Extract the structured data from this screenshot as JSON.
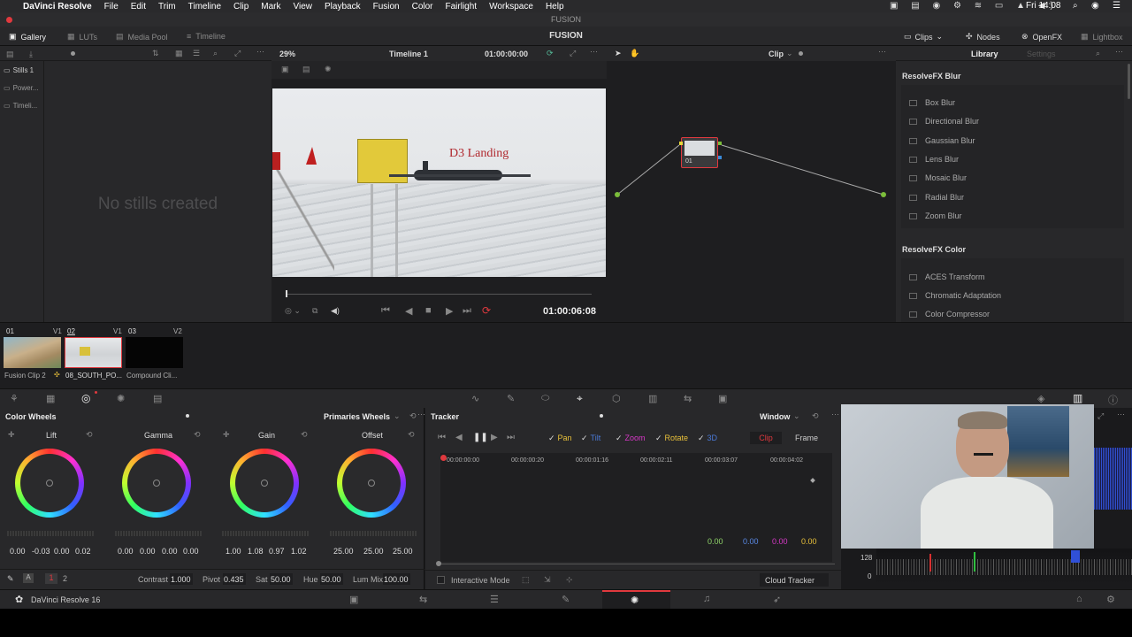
{
  "menubar": {
    "app": "DaVinci Resolve",
    "items": [
      "File",
      "Edit",
      "Trim",
      "Timeline",
      "Clip",
      "Mark",
      "View",
      "Playback",
      "Fusion",
      "Color",
      "Fairlight",
      "Workspace",
      "Help"
    ],
    "window_title": "FUSION",
    "clock": "Fri 14:08"
  },
  "toolbar": {
    "gallery": "Gallery",
    "luts": "LUTs",
    "media_pool": "Media Pool",
    "timeline": "Timeline",
    "page_title": "FUSION",
    "clips": "Clips",
    "nodes": "Nodes",
    "openfx": "OpenFX",
    "lightbox": "Lightbox"
  },
  "viewer": {
    "zoom": "29%",
    "timeline_name": "Timeline 1",
    "timecode_top": "01:00:00:00",
    "overlay_text": "D3 Landing",
    "timecode": "01:00:06:08"
  },
  "gallery": {
    "items": [
      "Stills 1",
      "Power...",
      "Timeli..."
    ],
    "empty_text": "No stills created"
  },
  "node_editor": {
    "mode": "Clip",
    "node_label": "01"
  },
  "library": {
    "tab_library": "Library",
    "tab_settings": "Settings",
    "blur_header": "ResolveFX Blur",
    "blur_items": [
      "Box Blur",
      "Directional Blur",
      "Gaussian Blur",
      "Lens Blur",
      "Mosaic Blur",
      "Radial Blur",
      "Zoom Blur"
    ],
    "color_header": "ResolveFX Color",
    "color_items": [
      "ACES Transform",
      "Chromatic Adaptation",
      "Color Compressor"
    ]
  },
  "clips": {
    "items": [
      {
        "num": "01",
        "track": "V1",
        "label": "Fusion Clip 2"
      },
      {
        "num": "02",
        "track": "V1",
        "label": "08_SOUTH_PO..."
      },
      {
        "num": "03",
        "track": "V2",
        "label": "Compound Cli..."
      }
    ]
  },
  "color_wheels": {
    "title": "Color Wheels",
    "mode": "Primaries Wheels",
    "wheels": [
      {
        "name": "Lift",
        "values": [
          "0.00",
          "-0.03",
          "0.00",
          "0.02"
        ]
      },
      {
        "name": "Gamma",
        "values": [
          "0.00",
          "0.00",
          "0.00",
          "0.00"
        ]
      },
      {
        "name": "Gain",
        "values": [
          "1.00",
          "1.08",
          "0.97",
          "1.02"
        ]
      },
      {
        "name": "Offset",
        "values": [
          "25.00",
          "25.00",
          "25.00"
        ]
      }
    ],
    "page1": "1",
    "page2": "2",
    "contrast_label": "Contrast",
    "contrast": "1.000",
    "pivot_label": "Pivot",
    "pivot": "0.435",
    "sat_label": "Sat",
    "sat": "50.00",
    "hue_label": "Hue",
    "hue": "50.00",
    "lummix_label": "Lum Mix",
    "lummix": "100.00"
  },
  "tracker": {
    "title": "Tracker",
    "window": "Window",
    "pan": "Pan",
    "tilt": "Tilt",
    "zoom": "Zoom",
    "rotate": "Rotate",
    "threed": "3D",
    "clip": "Clip",
    "frame": "Frame",
    "ruler": [
      "00:00:00:00",
      "00:00:00:20",
      "00:00:01:16",
      "00:00:02:11",
      "00:00:03:07",
      "00:00:04:02"
    ],
    "values": [
      "0.00",
      "0.00",
      "0.00",
      "0.00"
    ],
    "interactive": "Interactive Mode",
    "cloud": "Cloud Tracker"
  },
  "scope": {
    "label1": "128",
    "label2": "0"
  },
  "bottom": {
    "app_name": "DaVinci Resolve 16"
  },
  "colors": {
    "accent_red": "#e0393e",
    "panel": "#28282a",
    "bg": "#1c1c1e"
  }
}
